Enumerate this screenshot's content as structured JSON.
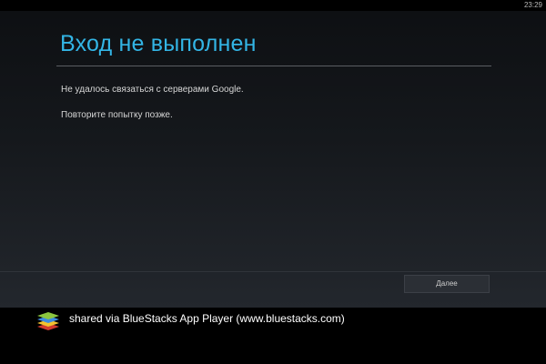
{
  "status_bar": {
    "time": "23:29"
  },
  "dialog": {
    "title": "Вход не выполнен",
    "message_line_1": "Не удалось связаться с серверами Google.",
    "message_line_2": "Повторите попытку позже.",
    "next_button_label": "Далее"
  },
  "banner": {
    "icon": "bluestacks-logo-icon",
    "text": "shared via BlueStacks App Player (www.bluestacks.com)"
  },
  "colors": {
    "title_accent": "#33b5e5",
    "background_dark": "#0d0f12",
    "banner_background": "#000000"
  }
}
